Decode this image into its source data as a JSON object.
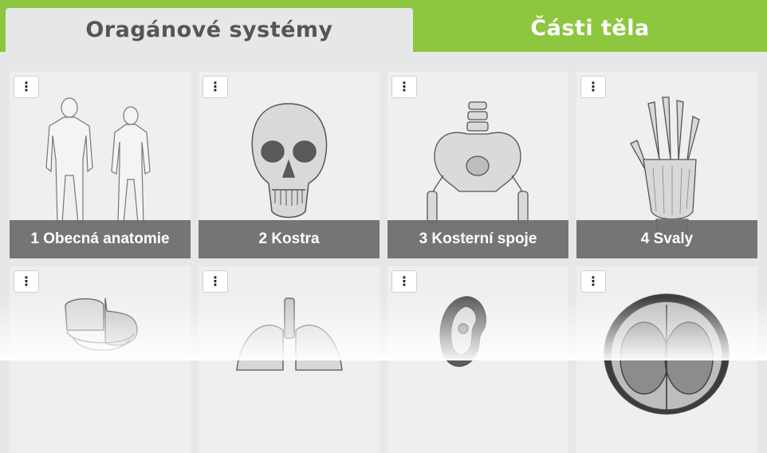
{
  "tabs": {
    "organ_systems": "Oragánové systémy",
    "body_parts": "Části těla"
  },
  "colors": {
    "tab_bar": "#8dc63f",
    "label_bg": "#6e6e6e"
  },
  "menu_glyph": "⋮",
  "cards": [
    {
      "label": "1 Obecná anatomie",
      "icon": "human-figures-icon"
    },
    {
      "label": "2 Kostra",
      "icon": "skull-icon"
    },
    {
      "label": "3 Kosterní spoje",
      "icon": "pelvis-icon"
    },
    {
      "label": "4 Svaly",
      "icon": "hand-muscles-icon"
    },
    {
      "label": "",
      "icon": "digestive-system-icon"
    },
    {
      "label": "",
      "icon": "lungs-icon"
    },
    {
      "label": "",
      "icon": "kidney-icon"
    },
    {
      "label": "",
      "icon": "brain-section-icon"
    }
  ]
}
